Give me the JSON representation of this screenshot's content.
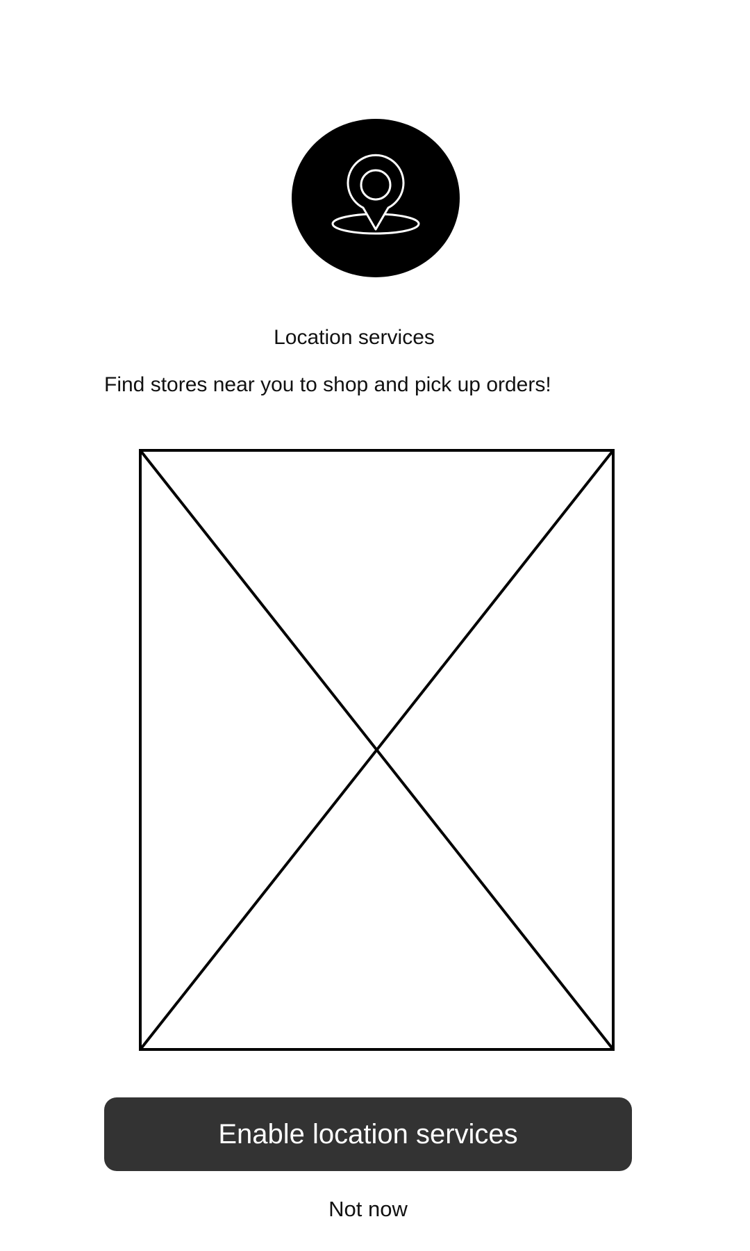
{
  "location_prompt": {
    "icon": "location-pin-icon",
    "title": "Location services",
    "description": "Find stores near you to shop and pick up orders!",
    "image_placeholder": "image-placeholder",
    "enable_button_label": "Enable location services",
    "not_now_label": "Not now"
  },
  "colors": {
    "icon_background": "#000000",
    "primary_button_background": "#333333",
    "primary_button_text": "#ffffff",
    "text": "#111111"
  }
}
